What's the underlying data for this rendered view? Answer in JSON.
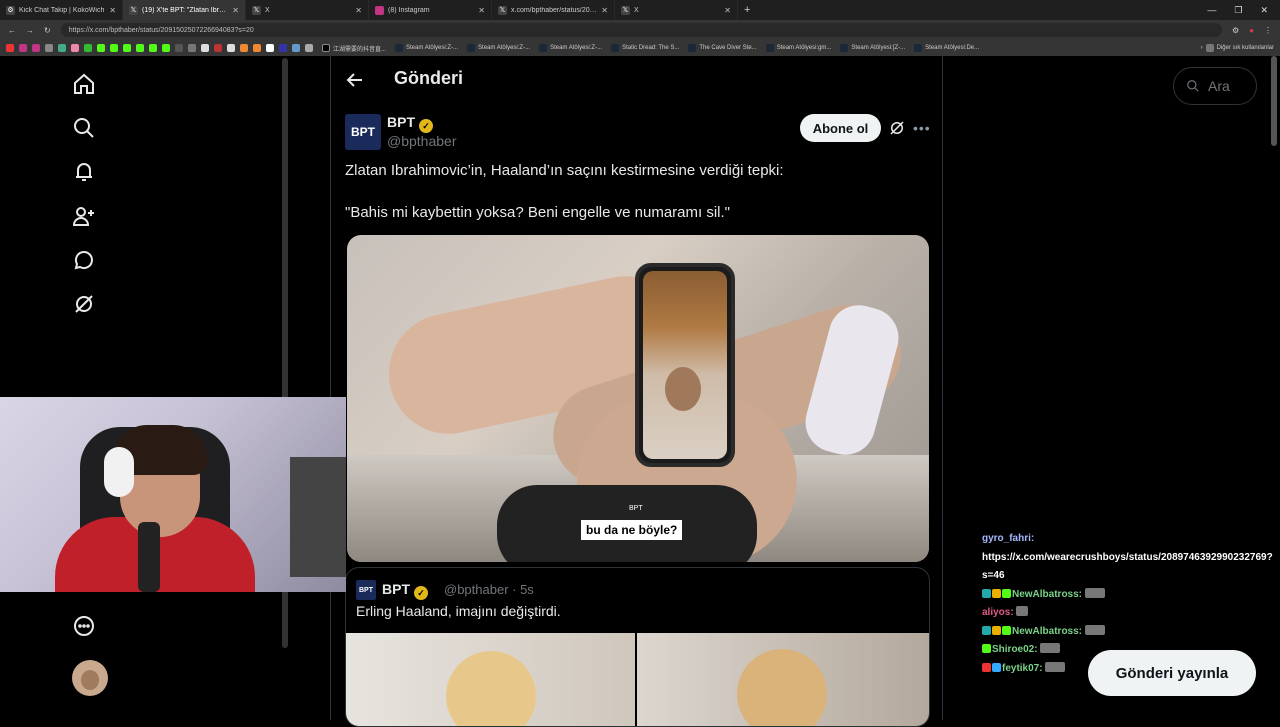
{
  "browser": {
    "tabs": [
      {
        "title": "Kick Chat Takip | KokoWich",
        "active": false
      },
      {
        "title": "(19) X'te BPT: \"Zlatan Ibrahim",
        "active": true
      },
      {
        "title": "X",
        "active": false
      },
      {
        "title": "(8) Instagram",
        "active": false
      },
      {
        "title": "x.com/bpthaber/status/20903720",
        "active": false
      },
      {
        "title": "X",
        "active": false
      }
    ],
    "url": "https://x.com/bpthaber/status/2091502507226694083?s=20",
    "bookmarks": [
      "江湖需要的抖音直...",
      "Steam Atölyesi:Z-...",
      "Steam Atölyesi:Z-...",
      "Steam Atölyesi:Z-...",
      "Static Dread: The S...",
      "The Cave Diver Ste...",
      "Steam Atölyesi:gm...",
      "Steam Atölyesi:[Z-...",
      "Steam Atölyesi:De..."
    ],
    "other_bookmarks": "Diğer sık kullanılanlar"
  },
  "header": {
    "title": "Gönderi"
  },
  "post": {
    "avatar_text": "BPT",
    "name": "BPT",
    "handle": "@bpthaber",
    "follow_label": "Abone ol",
    "text_line1": "Zlatan Ibrahimovic’in, Haaland’ın saçını kestirmesine verdiği tepki:",
    "text_line2": "\"Bahis mi kaybettin yoksa? Beni engelle ve numaramı sil.\"",
    "media_caption": "bu da ne böyle?",
    "media_watermark": "BPT"
  },
  "quote": {
    "avatar_text": "BPT",
    "name": "BPT",
    "meta": "@bpthaber · 5s",
    "text": "Erling Haaland, imajını değiştirdi."
  },
  "search": {
    "placeholder": "Ara"
  },
  "chat": [
    {
      "user": "gyro_fahri:",
      "message": "https://x.com/wearecrushboys/status/2089746392990232769?s=46"
    },
    {
      "user": "NewAlbatross:",
      "message": ""
    },
    {
      "user": "aliyos:",
      "message": ""
    },
    {
      "user": "NewAlbatross:",
      "message": ""
    },
    {
      "user": "Shiroe02:",
      "message": ""
    },
    {
      "user": "feytik07:",
      "message": ""
    }
  ],
  "publish_label": "Gönderi yayınla",
  "icons": [
    "home-icon",
    "search-icon",
    "bell-icon",
    "follow-icon",
    "chat-icon",
    "grok-icon",
    "profile-icon",
    "more-icon"
  ]
}
